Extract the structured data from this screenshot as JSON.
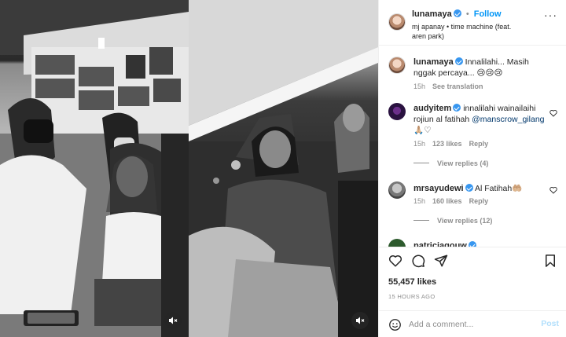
{
  "header": {
    "username": "lunamaya",
    "follow_label": "Follow",
    "separator": "•",
    "audio": "mj apanay • time machine (feat. aren park)"
  },
  "caption": {
    "username": "lunamaya",
    "text": "Innalilahi... Masih nggak percaya... 😢😢😢",
    "time": "15h",
    "see_translation": "See translation"
  },
  "comments": [
    {
      "username": "audyitem",
      "text": "innalilahi wainailaihi rojiun al fatihah",
      "mention": "@manscrow_gilang",
      "emoji_after": " 🙏🏼♡",
      "time": "15h",
      "likes": "123 likes",
      "reply": "Reply",
      "view_replies": "View replies (4)"
    },
    {
      "username": "mrsayudewi",
      "text": "Al Fatihah🤲🏼",
      "time": "15h",
      "likes": "160 likes",
      "reply": "Reply",
      "view_replies": "View replies (12)"
    },
    {
      "username": "patriciagouw"
    }
  ],
  "actions": {
    "likes": "55,457 likes",
    "time_ago": "15 HOURS AGO",
    "add_comment_placeholder": "Add a comment...",
    "post_label": "Post"
  },
  "colors": {
    "accent": "#0095f6",
    "verified": "#3897f0",
    "text": "#262626",
    "muted": "#8e8e8e",
    "post_disabled": "#b2dffc"
  }
}
